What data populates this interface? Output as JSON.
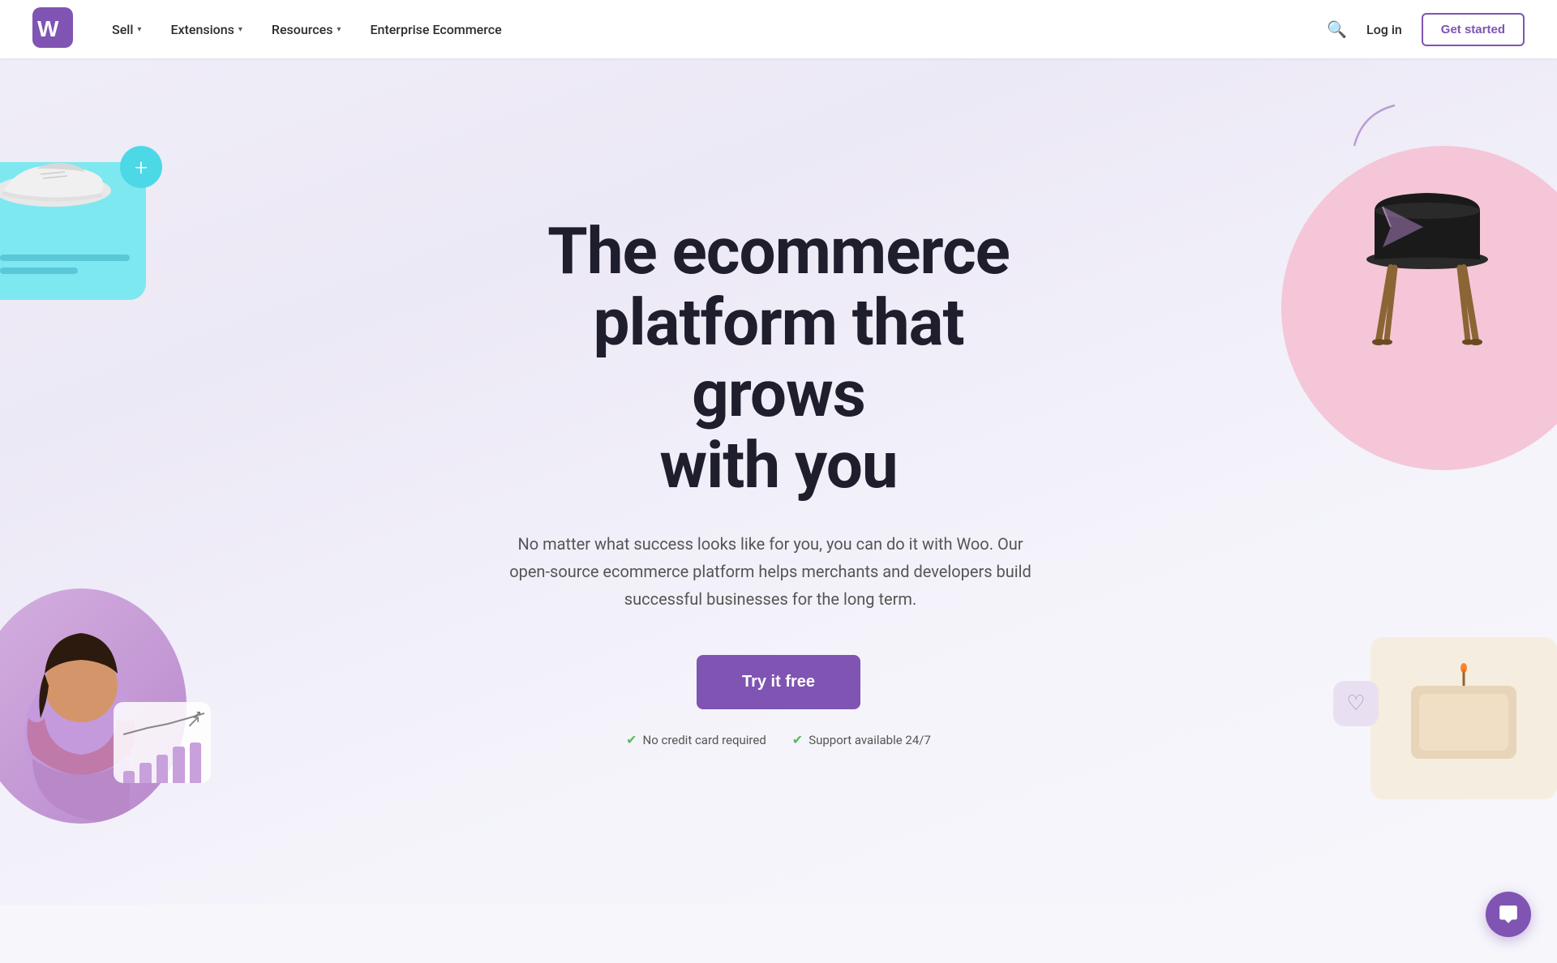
{
  "nav": {
    "logo_alt": "WooCommerce",
    "sell_label": "Sell",
    "extensions_label": "Extensions",
    "resources_label": "Resources",
    "enterprise_label": "Enterprise Ecommerce",
    "login_label": "Log in",
    "get_started_label": "Get started"
  },
  "hero": {
    "title_line1": "The ecommerce",
    "title_line2": "platform that grows",
    "title_line3": "with you",
    "subtitle": "No matter what success looks like for you, you can do it with Woo. Our open-source ecommerce platform helps merchants and developers build successful businesses for the long term.",
    "cta_label": "Try it free",
    "badge1": "No credit card required",
    "badge2": "Support available 24/7"
  },
  "chat": {
    "icon": "💬"
  },
  "colors": {
    "brand_purple": "#7f54b3",
    "teal_card": "#7ee8f0",
    "pink_circle": "#f5c6d8",
    "check_green": "#5cb85c"
  }
}
